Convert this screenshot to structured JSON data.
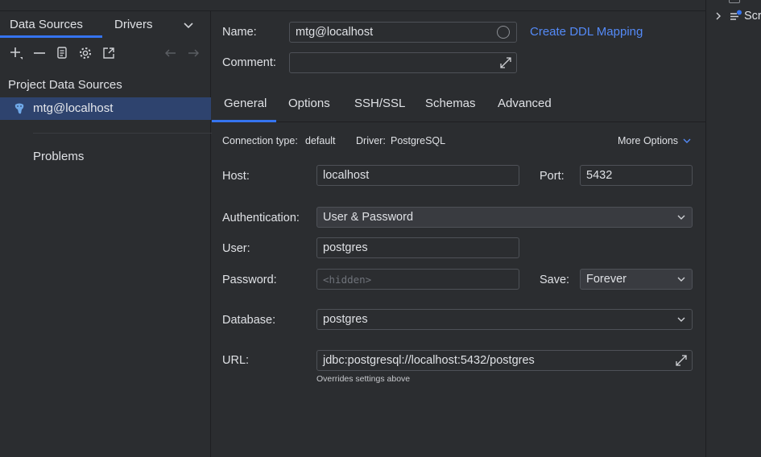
{
  "left_panel": {
    "tabs": [
      "Data Sources",
      "Drivers"
    ],
    "section_title": "Project Data Sources",
    "items": [
      {
        "label": "mtg@localhost"
      }
    ],
    "problems_label": "Problems"
  },
  "form": {
    "name_label": "Name:",
    "name_value": "mtg@localhost",
    "ddl_link": "Create DDL Mapping",
    "comment_label": "Comment:",
    "comment_value": ""
  },
  "tabs": [
    "General",
    "Options",
    "SSH/SSL",
    "Schemas",
    "Advanced"
  ],
  "general": {
    "connection_type_label": "Connection type:",
    "connection_type_value": "default",
    "driver_label": "Driver:",
    "driver_value": "PostgreSQL",
    "more_options": "More Options",
    "host_label": "Host:",
    "host_value": "localhost",
    "port_label": "Port:",
    "port_value": "5432",
    "auth_label": "Authentication:",
    "auth_value": "User & Password",
    "user_label": "User:",
    "user_value": "postgres",
    "password_label": "Password:",
    "password_placeholder": "<hidden>",
    "save_label": "Save:",
    "save_value": "Forever",
    "database_label": "Database:",
    "database_value": "postgres",
    "url_label": "URL:",
    "url_value": "jdbc:postgresql://localhost:5432/postgres",
    "url_hint": "Overrides settings above"
  },
  "right_panel": {
    "label": "Scr"
  },
  "colors": {
    "accent": "#3574f0",
    "link": "#548af7",
    "selection": "#2e436e",
    "background": "#2b2d30"
  }
}
